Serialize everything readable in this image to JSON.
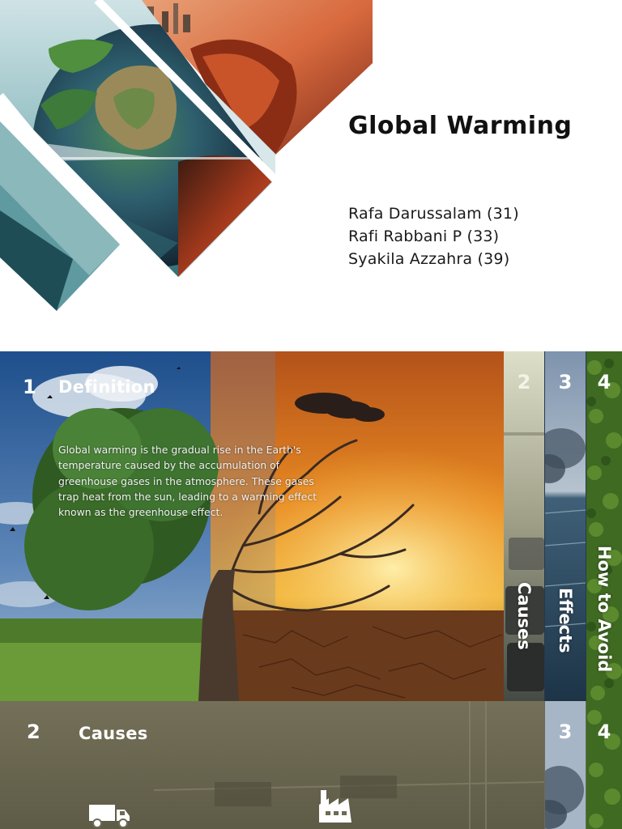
{
  "slide1": {
    "title": "Global Warming",
    "authors": [
      "Rafa Darussalam (31)",
      "Rafi Rabbani P (33)",
      "Syakila Azzahra (39)"
    ]
  },
  "slide2": {
    "section_number": "1",
    "section_title": "Definition",
    "body": "Global warming is the gradual rise in the Earth's temperature caused by the accumulation of greenhouse gases in the atmosphere. These gases trap heat from the sun, leading to a warming effect known as the greenhouse effect.",
    "tabs": [
      {
        "number": "2",
        "label": "Causes"
      },
      {
        "number": "3",
        "label": "Effects"
      },
      {
        "number": "4",
        "label": "How to Avoid"
      }
    ]
  },
  "slide3": {
    "section_number": "2",
    "section_title": "Causes",
    "tabs": [
      {
        "number": "3"
      },
      {
        "number": "4"
      }
    ],
    "icons": [
      "truck-icon",
      "factory-icon"
    ]
  }
}
